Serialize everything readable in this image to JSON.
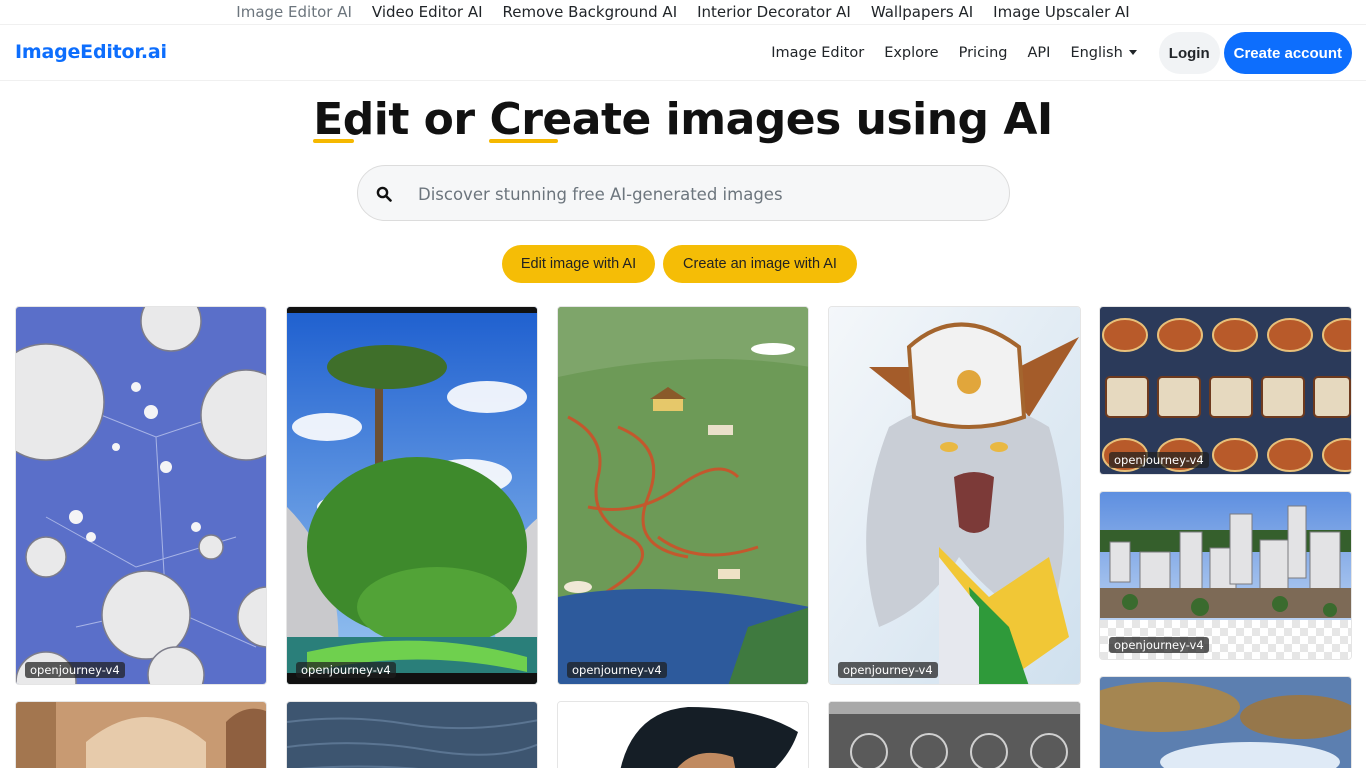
{
  "top_links": [
    {
      "label": "Image Editor AI",
      "active": true
    },
    {
      "label": "Video Editor AI",
      "active": false
    },
    {
      "label": "Remove Background AI",
      "active": false
    },
    {
      "label": "Interior Decorator AI",
      "active": false
    },
    {
      "label": "Wallpapers AI",
      "active": false
    },
    {
      "label": "Image Upscaler AI",
      "active": false
    }
  ],
  "nav": {
    "brand": "ImageEditor.ai",
    "links": [
      "Image Editor",
      "Explore",
      "Pricing",
      "API"
    ],
    "language": "English",
    "login": "Login",
    "create_account": "Create account"
  },
  "hero": {
    "title_parts": [
      "Edit",
      " or ",
      "Create",
      " images using AI"
    ]
  },
  "search": {
    "placeholder": "Discover stunning free AI-generated images"
  },
  "actions": {
    "edit": "Edit image with AI",
    "create": "Create an image with AI"
  },
  "gallery": [
    {
      "name": "spheres",
      "model": "openjourney-v4"
    },
    {
      "name": "tree-island",
      "model": "openjourney-v4"
    },
    {
      "name": "river-map",
      "model": "openjourney-v4"
    },
    {
      "name": "white-wolf",
      "model": "openjourney-v4"
    },
    {
      "name": "pattern",
      "model": "openjourney-v4"
    },
    {
      "name": "city",
      "model": "openjourney-v4"
    }
  ],
  "colors": {
    "accent": "#0d6efd",
    "highlight": "#f5bd06"
  }
}
